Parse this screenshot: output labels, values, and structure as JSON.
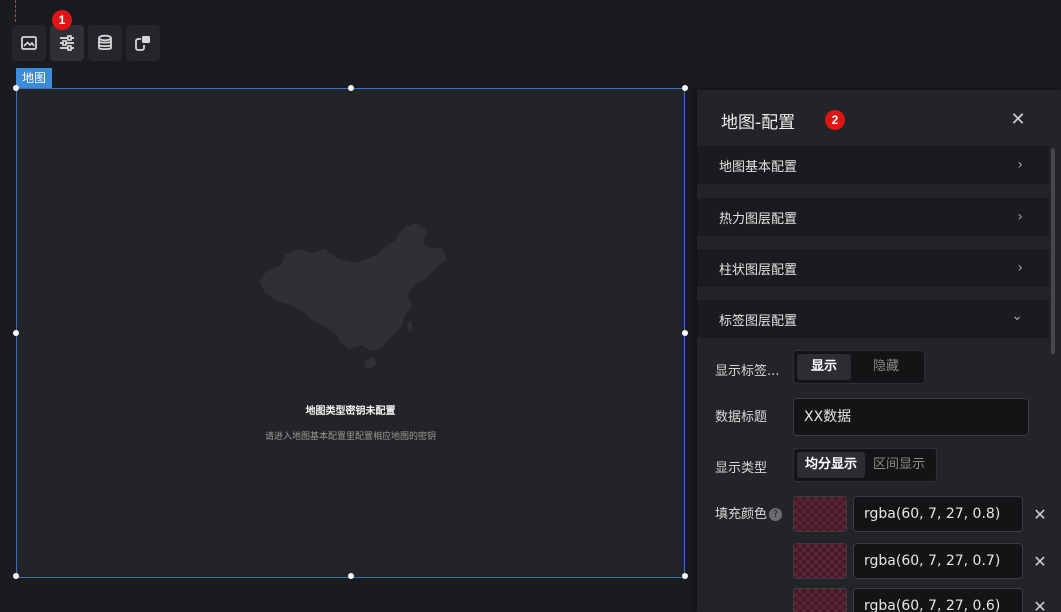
{
  "toolbar": {
    "tools": [
      {
        "icon": "image-icon"
      },
      {
        "icon": "sliders-icon"
      },
      {
        "icon": "database-icon"
      },
      {
        "icon": "interaction-icon"
      }
    ],
    "marker": "1"
  },
  "canvas": {
    "tag": "地图",
    "title": "地图类型密钥未配置",
    "subtitle": "请进入地图基本配置里配置相应地图的密钥"
  },
  "panel": {
    "title": "地图-配置",
    "marker": "2",
    "close": "✕",
    "sections": [
      {
        "label": "地图基本配置",
        "chevron": "›"
      },
      {
        "label": "热力图层配置",
        "chevron": "›"
      },
      {
        "label": "柱状图层配置",
        "chevron": "›"
      },
      {
        "label": "标签图层配置",
        "chevron": "⌄"
      }
    ],
    "show_label": {
      "label": "显示标签...",
      "options": [
        "显示",
        "隐藏"
      ],
      "selected": "显示"
    },
    "data_title": {
      "label": "数据标题",
      "value": "XX数据"
    },
    "display_type": {
      "label": "显示类型",
      "options": [
        "均分显示",
        "区间显示"
      ],
      "selected": "均分显示"
    },
    "fill_color": {
      "label": "填充颜色",
      "help": "?",
      "remove": "✕",
      "values": [
        "rgba(60, 7, 27, 0.8)",
        "rgba(60, 7, 27, 0.7)",
        "rgba(60, 7, 27, 0.6)"
      ]
    }
  },
  "colors": {
    "accent": "#3a8bd9",
    "marker": "#e01414",
    "panel_bg": "#232427",
    "page_bg": "#1a1b1e"
  }
}
